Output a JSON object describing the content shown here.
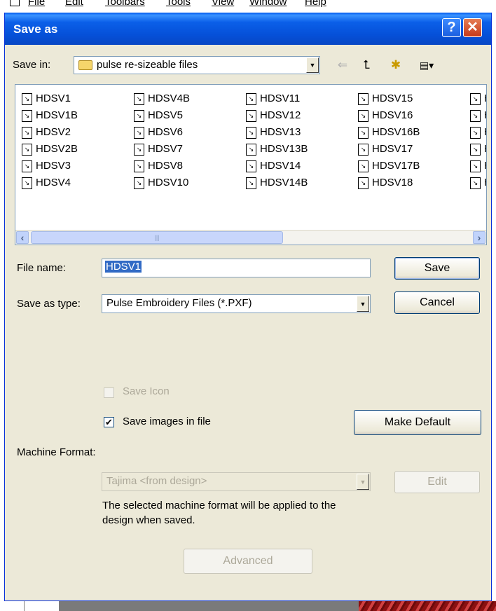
{
  "menubar": {
    "items": [
      "File",
      "Edit",
      "Toolbars",
      "Tools",
      "View",
      "Window",
      "Help"
    ]
  },
  "dialog": {
    "title": "Save as",
    "help_glyph": "?",
    "close_glyph": "✕"
  },
  "save_in": {
    "label": "Save in:",
    "value": "pulse re-sizeable files"
  },
  "nav": {
    "back_glyph": "⇐",
    "up_glyph": "⮤",
    "new_glyph": "✱",
    "view_glyph": "▤▾"
  },
  "files": [
    "HDSV1",
    "HDSV1B",
    "HDSV2",
    "HDSV2B",
    "HDSV3",
    "HDSV4",
    "HDSV4B",
    "HDSV5",
    "HDSV6",
    "HDSV7",
    "HDSV8",
    "HDSV10",
    "HDSV11",
    "HDSV12",
    "HDSV13",
    "HDSV13B",
    "HDSV14",
    "HDSV14B",
    "HDSV15",
    "HDSV16",
    "HDSV16B",
    "HDSV17",
    "HDSV17B",
    "HDSV18",
    "H",
    "H",
    "H",
    "H",
    "H",
    "H"
  ],
  "scrollbar": {
    "left_glyph": "‹",
    "right_glyph": "›",
    "thumb_grip": "|||"
  },
  "file_name": {
    "label": "File name:",
    "value": "HDSV1"
  },
  "save_type": {
    "label": "Save as type:",
    "value": "Pulse Embroidery Files (*.PXF)"
  },
  "buttons": {
    "save": "Save",
    "cancel": "Cancel",
    "make_default": "Make Default",
    "edit": "Edit",
    "advanced": "Advanced"
  },
  "checkboxes": {
    "save_icon": {
      "label": "Save Icon",
      "checked": false
    },
    "save_images": {
      "label": "Save images in file",
      "checked": true,
      "mark": "✔"
    }
  },
  "machine_format": {
    "label": "Machine Format:",
    "value": "Tajima <from design>",
    "note_line1": "The selected machine format will be applied to the",
    "note_line2": "design when saved."
  },
  "dropdown_glyph": "▼",
  "colors": {
    "titlebar": "#0b5fe8",
    "dialog_bg": "#ece9d8",
    "selection": "#316ac5",
    "close_button": "#c6391a"
  }
}
